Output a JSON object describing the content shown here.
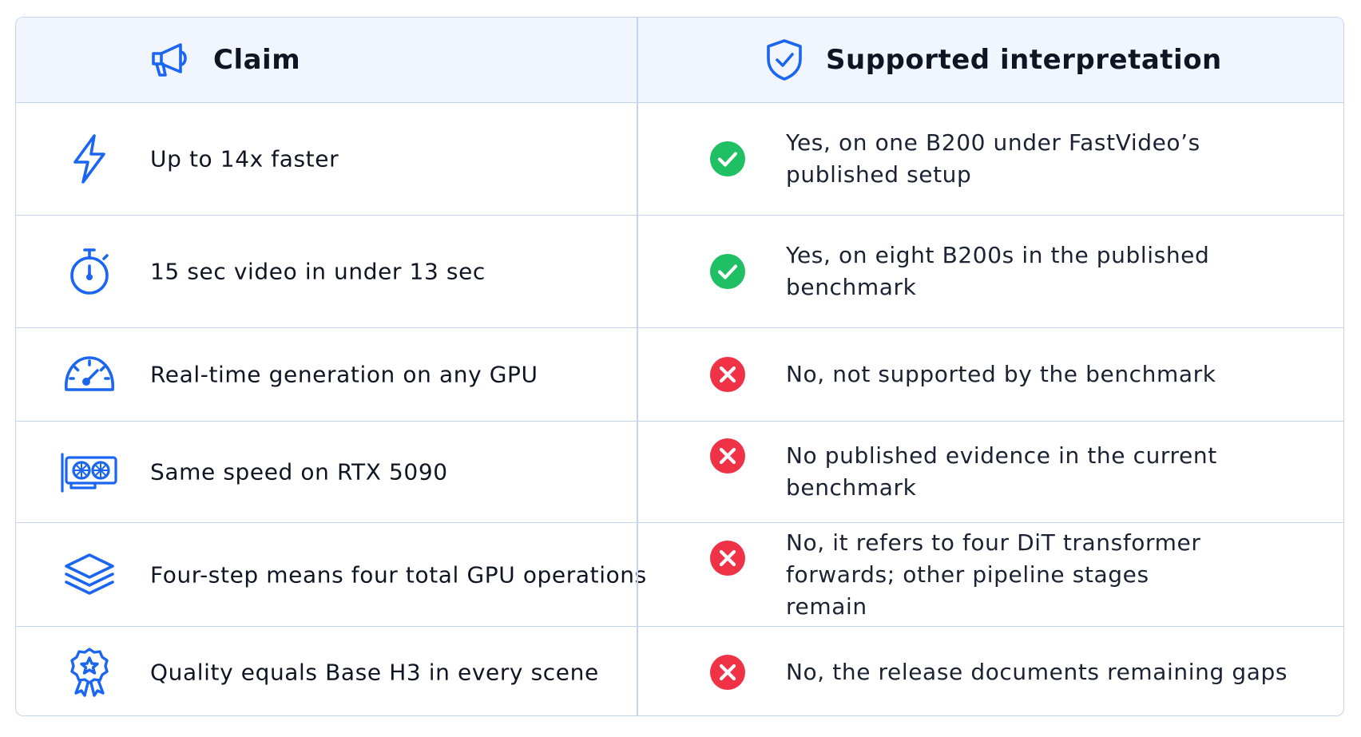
{
  "header": {
    "claim_label": "Claim",
    "claim_icon": "megaphone-icon",
    "interp_label": "Supported interpretation",
    "interp_icon": "shield-check-icon"
  },
  "colors": {
    "accent_blue": "#1a66f0",
    "check_green": "#1fbf63",
    "cross_red": "#ef3246",
    "header_bg": "#f1f6fe",
    "border": "#c5d3ee"
  },
  "rows": [
    {
      "icon": "lightning-icon",
      "claim": "Up to 14x faster",
      "verdict": "supported",
      "verdict_icon": "check-circle-icon",
      "interpretation": "Yes, on one B200 under FastVideo’s published setup"
    },
    {
      "icon": "stopwatch-icon",
      "claim": "15 sec video in under 13 sec",
      "verdict": "supported",
      "verdict_icon": "check-circle-icon",
      "interpretation": "Yes, on eight B200s in the published benchmark"
    },
    {
      "icon": "speedometer-icon",
      "claim": "Real-time generation on any GPU",
      "verdict": "unsupported",
      "verdict_icon": "x-circle-icon",
      "interpretation": "No, not supported by the benchmark"
    },
    {
      "icon": "gpu-card-icon",
      "claim": "Same speed on RTX 5090",
      "verdict": "unsupported",
      "verdict_icon": "x-circle-icon",
      "interpretation": "No published evidence in the current benchmark"
    },
    {
      "icon": "layers-icon",
      "claim": "Four-step means four total GPU operations",
      "verdict": "unsupported",
      "verdict_icon": "x-circle-icon",
      "interpretation": "No, it refers to four DiT transformer forwards; other pipeline stages remain"
    },
    {
      "icon": "award-badge-icon",
      "claim": "Quality equals Base H3 in every scene",
      "verdict": "unsupported",
      "verdict_icon": "x-circle-icon",
      "interpretation": "No, the release documents remaining gaps"
    }
  ]
}
